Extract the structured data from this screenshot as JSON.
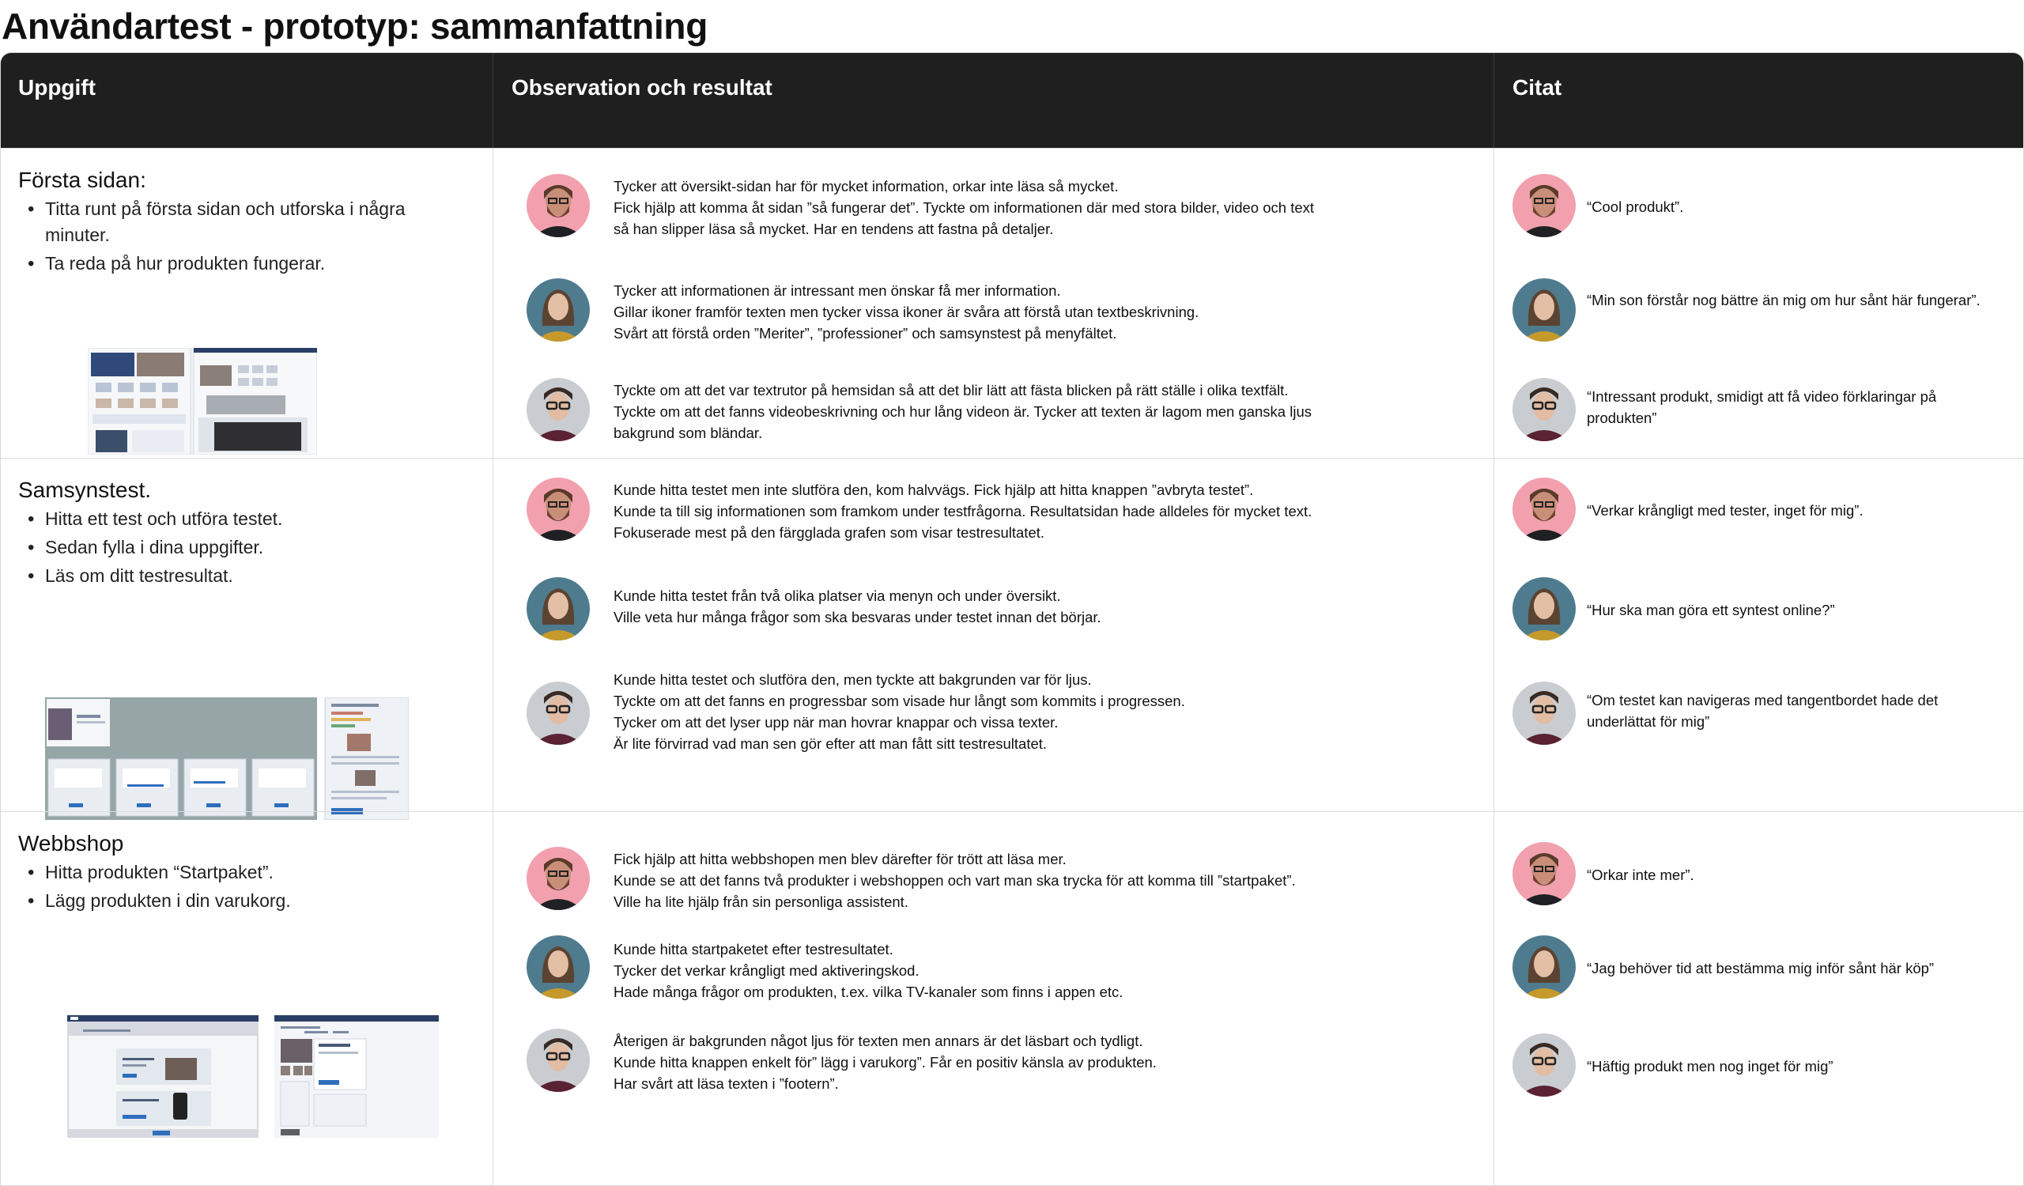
{
  "title": "Användartest - prototyp: sammanfattning",
  "columns": [
    "Uppgift",
    "Observation och resultat",
    "Citat"
  ],
  "rows": [
    {
      "task_title": "Första sidan:",
      "task_items": [
        "Titta runt på första sidan och utforska i några minuter.",
        "Ta reda på hur produkten fungerar."
      ],
      "observations": [
        [
          "Tycker att översikt-sidan har för mycket information, orkar inte läsa så mycket.",
          "Fick hjälp att komma åt sidan ”så fungerar det”. Tyckte om informationen där med stora bilder, video och text",
          "så han slipper läsa så mycket. Har en tendens att fastna på detaljer."
        ],
        [
          "Tycker att informationen är intressant men önskar få mer information.",
          "Gillar ikoner framför texten men tycker vissa ikoner är svåra att förstå utan textbeskrivning.",
          "Svårt att förstå orden ”Meriter”, ”professioner” och samsynstest på menyfältet."
        ],
        [
          "Tyckte om att det var textrutor på hemsidan så att det blir lätt att fästa blicken på rätt ställe i olika textfält.",
          "Tyckte om att det fanns videobeskrivning och hur lång videon är. Tycker att texten är lagom men ganska ljus",
          "bakgrund som bländar."
        ]
      ],
      "quotes": [
        "“Cool produkt”.",
        "“Min son förstår nog bättre än mig om hur sånt här fungerar”.",
        "“Intressant produkt, smidigt att få video förklaringar på produkten”"
      ]
    },
    {
      "task_title": "Samsynstest.",
      "task_items": [
        "Hitta ett test och utföra testet.",
        "Sedan fylla i dina uppgifter.",
        "Läs om ditt testresultat."
      ],
      "observations": [
        [
          "Kunde hitta testet men inte slutföra den, kom halvvägs. Fick hjälp att hitta knappen ”avbryta testet”.",
          "Kunde ta till sig informationen som framkom under testfrågorna. Resultatsidan hade alldeles för mycket text.",
          "Fokuserade mest på den färgglada grafen som visar testresultatet."
        ],
        [
          "Kunde hitta testet från två olika platser via menyn och under översikt.",
          "Ville veta hur många frågor som ska besvaras under testet innan det börjar."
        ],
        [
          "Kunde hitta testet och slutföra den, men tyckte att bakgrunden var för ljus.",
          "Tyckte om att det fanns en progressbar som visade hur långt som kommits i progressen.",
          "Tycker om att det lyser upp när man hovrar knappar och vissa texter.",
          "Är lite förvirrad vad man sen gör efter att man fått sitt testresultatet."
        ]
      ],
      "quotes": [
        "“Verkar krångligt med tester, inget för mig”.",
        "“Hur ska man göra ett syntest online?”",
        "“Om testet kan navigeras med tangentbordet hade det underlättat för mig”"
      ]
    },
    {
      "task_title": "Webbshop",
      "task_items": [
        "Hitta produkten “Startpaket”.",
        "Lägg produkten i din varukorg."
      ],
      "observations": [
        [
          "Fick hjälp att hitta webbshopen men blev därefter för trött att läsa mer.",
          "Kunde se att det fanns två produkter i webshoppen och vart man ska trycka för att komma till ”startpaket”.",
          "Ville ha lite hjälp från sin personliga assistent."
        ],
        [
          "Kunde hitta startpaketet efter testresultatet.",
          "Tycker det verkar krångligt med aktiveringskod.",
          "Hade många frågor om produkten, t.ex. vilka TV-kanaler som finns i appen etc."
        ],
        [
          "Återigen är bakgrunden något ljus för texten men annars är det läsbart och tydligt.",
          "Kunde hitta knappen enkelt för” lägg i varukorg”. Får en positiv känsla av produkten.",
          "Har svårt att läsa texten i ”footern”."
        ]
      ],
      "quotes": [
        "“Orkar inte mer”.",
        "“Jag behöver tid att bestämma mig inför sånt här köp”",
        "“Häftig produkt men nog inget för mig”"
      ]
    }
  ],
  "persona_colors": {
    "persona-1": "#f2a0ad",
    "persona-2": "#4f7b8e",
    "persona-3": "#c9cdd2"
  }
}
